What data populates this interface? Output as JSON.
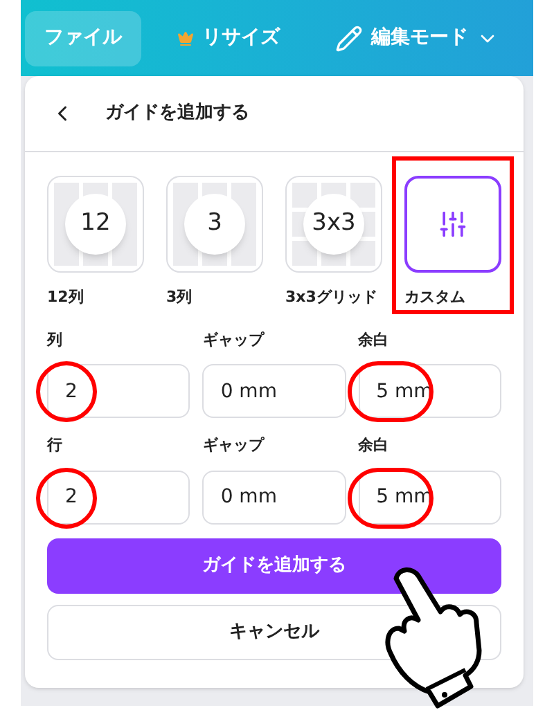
{
  "toolbar": {
    "items": [
      {
        "kind": "plain",
        "label": "ファイル",
        "selected": true
      },
      {
        "kind": "crown",
        "label": "リサイズ",
        "selected": false
      },
      {
        "kind": "edit",
        "label": "編集モード",
        "selected": false
      }
    ]
  },
  "panel": {
    "title": "ガイドを追加する",
    "presets": [
      {
        "kind": "columns",
        "number": "12",
        "label": "12列",
        "selected": false,
        "highlighted": false
      },
      {
        "kind": "columns",
        "number": "3",
        "label": "3列",
        "selected": false,
        "highlighted": false
      },
      {
        "kind": "grid",
        "number": "3x3",
        "label": "3x3グリッド",
        "selected": false,
        "highlighted": false
      },
      {
        "kind": "custom",
        "label": "カスタム",
        "selected": true,
        "highlighted": true
      }
    ],
    "rows": [
      {
        "fields": [
          {
            "label": "列",
            "value": "2",
            "circled": true
          },
          {
            "label": "ギャップ",
            "value": "0 mm",
            "circled": false
          },
          {
            "label": "余白",
            "value": "5 mm",
            "circled": true
          }
        ]
      },
      {
        "fields": [
          {
            "label": "行",
            "value": "2",
            "circled": true
          },
          {
            "label": "ギャップ",
            "value": "0 mm",
            "circled": false
          },
          {
            "label": "余白",
            "value": "5 mm",
            "circled": true
          }
        ]
      }
    ],
    "primary_button": "ガイドを追加する",
    "cancel_button": "キャンセル"
  }
}
